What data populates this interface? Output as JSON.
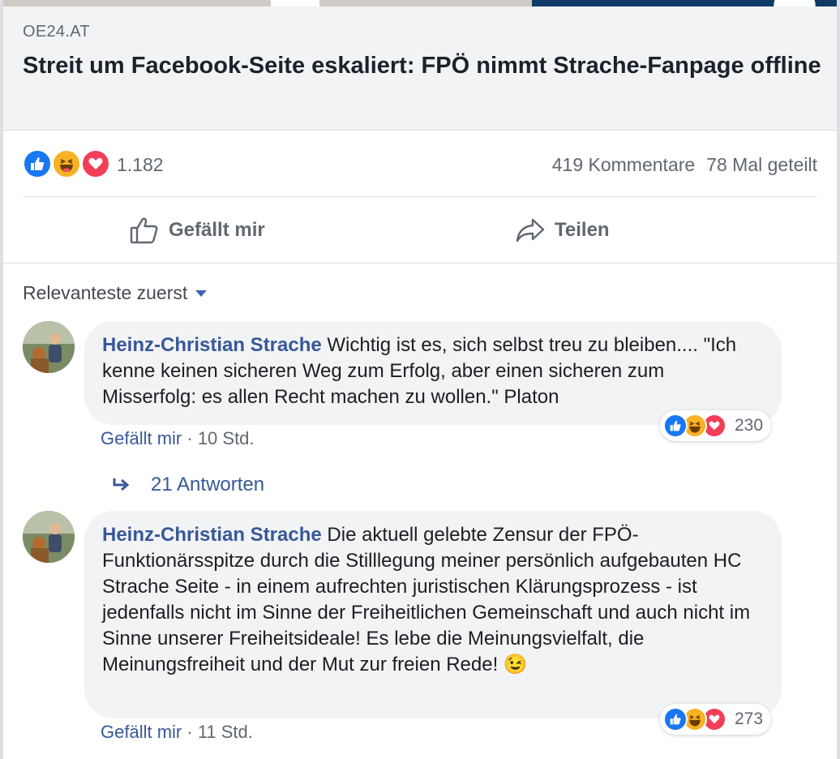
{
  "post": {
    "domain": "OE24.AT",
    "headline": "Streit um Facebook-Seite eskaliert: FPÖ nimmt Strache-Fanpage offline",
    "info_icon": "info-icon",
    "reaction_count": "1.182",
    "comments": "419 Kommentare",
    "shares": "78 Mal geteilt"
  },
  "actions": {
    "like_label": "Gefällt mir",
    "share_label": "Teilen"
  },
  "sort": {
    "label": "Relevanteste zuerst"
  },
  "comments": [
    {
      "author": "Heinz-Christian Strache",
      "text": "Wichtig ist es, sich selbst treu zu bleiben.... \"Ich kenne keinen sicheren Weg zum Erfolg, aber einen sicheren zum Misserfolg: es allen Recht machen zu wollen.\" Platon",
      "reactions": "230",
      "like_label": "Gefällt mir",
      "time": "10 Std.",
      "replies": "21 Antworten"
    },
    {
      "author": "Heinz-Christian Strache",
      "text": "Die aktuell gelebte Zensur der FPÖ-Funktionärsspitze durch die Stilllegung meiner persönlich aufgebauten HC Strache Seite - in einem aufrechten juristischen Klärungsprozess - ist jedenfalls nicht im Sinne der Freiheitlichen Gemeinschaft und auch nicht im Sinne unserer Freiheitsideale! Es lebe die Meinungsvielfalt, die Meinungsfreiheit und der Mut zur freien Rede! 😉",
      "reactions": "273",
      "like_label": "Gefällt mir",
      "time": "11 Std."
    }
  ],
  "separator": " · ",
  "colors": {
    "link_blue": "#385898",
    "like_blue": "#1877f2",
    "haha_yellow": "#f7b125",
    "love_red": "#f33e58"
  }
}
